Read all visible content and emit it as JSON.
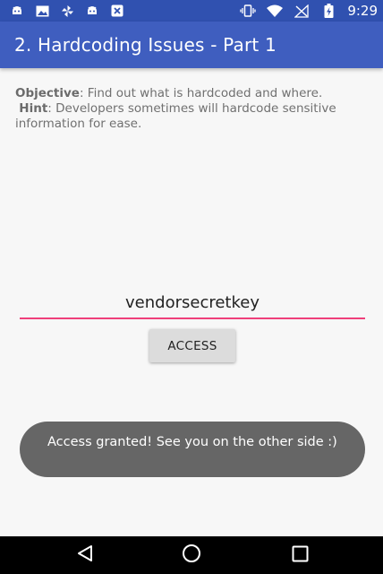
{
  "status_bar": {
    "time": "9:29",
    "left_icons": [
      "android-icon",
      "image-icon",
      "pinwheel-icon",
      "android-icon",
      "close-box-icon"
    ],
    "right_icons": [
      "vibrate-icon",
      "wifi-icon",
      "no-signal-icon",
      "battery-charging-icon"
    ]
  },
  "app_bar": {
    "title": "2. Hardcoding Issues - Part 1",
    "color": "#3f5ebf"
  },
  "info": {
    "objective_label": "Objective",
    "objective_text": ": Find out what is hardcoded and where.",
    "hint_label": "Hint",
    "hint_text": ": Developers sometimes will hardcode sensitive information for ease."
  },
  "form": {
    "input_value": "vendorsecretkey",
    "accent_color": "#ef3f7a",
    "access_label": "ACCESS"
  },
  "toast": {
    "message": "Access granted! See you on the other side :)"
  },
  "nav_bar": {
    "buttons": [
      "back-icon",
      "home-icon",
      "recents-icon"
    ]
  }
}
